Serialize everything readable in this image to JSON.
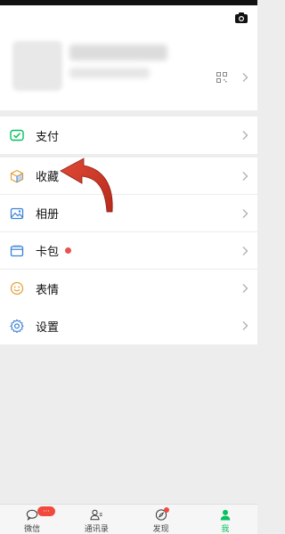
{
  "menu": {
    "pay": {
      "label": "支付"
    },
    "favorites": {
      "label": "收藏"
    },
    "album": {
      "label": "相册"
    },
    "cards": {
      "label": "卡包"
    },
    "stickers": {
      "label": "表情"
    },
    "settings": {
      "label": "设置"
    }
  },
  "tabbar": {
    "chats": {
      "label": "微信",
      "badge": "···"
    },
    "contacts": {
      "label": "通讯录"
    },
    "discover": {
      "label": "发现"
    },
    "me": {
      "label": "我"
    }
  },
  "colors": {
    "accent": "#07c160",
    "badge": "#f04a3e",
    "annotation_arrow": "#d2392b"
  }
}
